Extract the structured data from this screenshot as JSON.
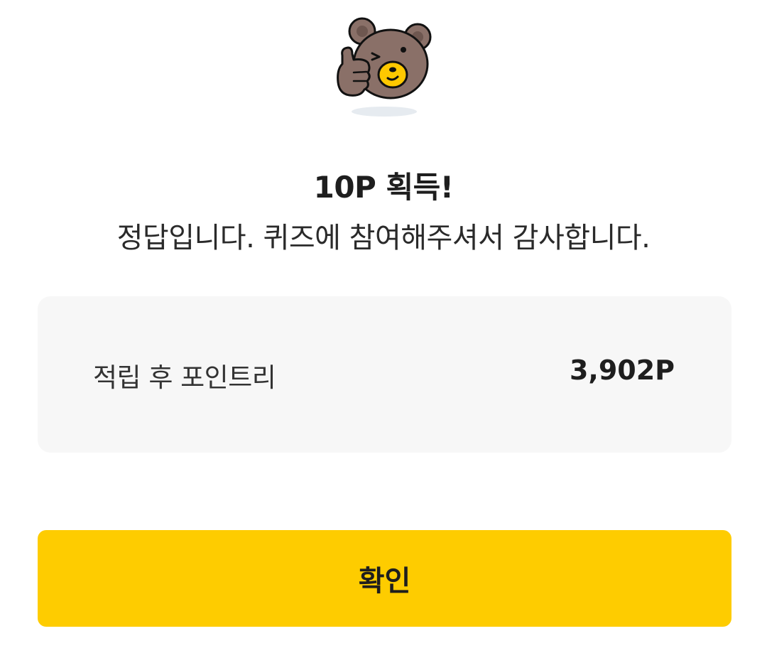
{
  "mascot": {
    "icon": "bear-thumbs-up-icon",
    "colors": {
      "fur": "#8a7068",
      "muzzle": "#fec800",
      "outline": "#111111"
    }
  },
  "result": {
    "title": "10P 획득!",
    "message": "정답입니다. 퀴즈에 참여해주셔서 감사합니다."
  },
  "points": {
    "label": "적립 후 포인트리",
    "value": "3,902P"
  },
  "confirm": {
    "label": "확인",
    "color": "#fecc00"
  }
}
